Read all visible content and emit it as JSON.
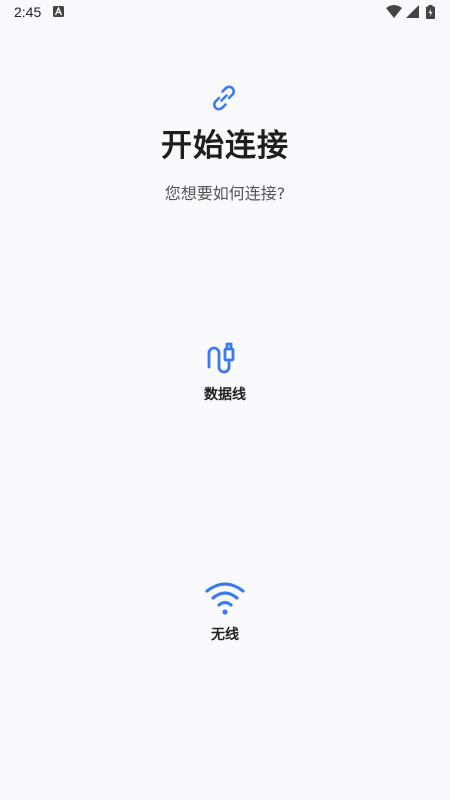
{
  "status_bar": {
    "time": "2:45",
    "icons": [
      "notification-a-icon",
      "wifi-signal-icon",
      "cell-signal-icon",
      "battery-charging-icon"
    ]
  },
  "header": {
    "icon": "link-icon",
    "title": "开始连接",
    "subtitle": "您想要如何连接?"
  },
  "options": [
    {
      "id": "usb",
      "icon": "usb-cable-icon",
      "label": "数据线"
    },
    {
      "id": "wireless",
      "icon": "wifi-icon",
      "label": "无线"
    }
  ],
  "colors": {
    "accent": "#3A7BF0",
    "background": "#FAFAFE",
    "title_text": "#1E1E1E",
    "subtitle_text": "#555555"
  }
}
